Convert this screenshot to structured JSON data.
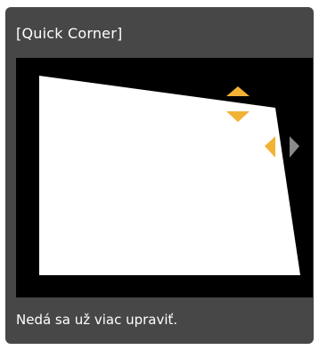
{
  "dialog": {
    "title": "[Quick Corner]",
    "message": "Nedá sa už viac upraviť."
  },
  "colors": {
    "panel": "#474747",
    "preview_background": "#000000",
    "image_area": "#ffffff",
    "active_arrow": "#f2b234",
    "inactive_arrow": "#8a8a8a"
  },
  "icons": {
    "up": "arrow-up-icon",
    "down": "arrow-down-icon",
    "left": "arrow-left-icon",
    "right": "arrow-right-icon"
  }
}
